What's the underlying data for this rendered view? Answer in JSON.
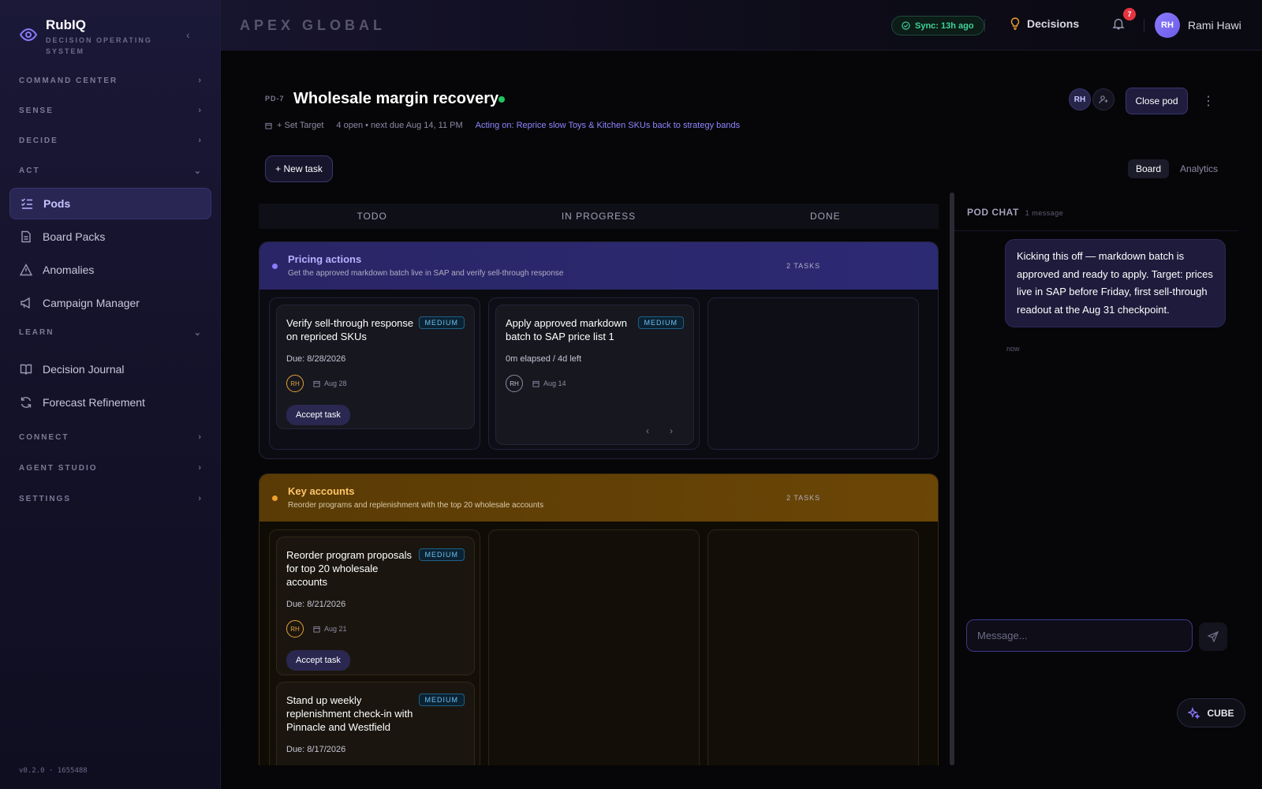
{
  "brand": {
    "name": "RubIQ",
    "tagline": "DECISION OPERATING SYSTEM"
  },
  "sidebar": {
    "sections": {
      "command_center": "COMMAND CENTER",
      "sense": "SENSE",
      "decide": "DECIDE",
      "act": "ACT",
      "learn": "LEARN",
      "connect": "CONNECT",
      "agent_studio": "AGENT STUDIO",
      "settings": "SETTINGS"
    },
    "act_items": [
      "Pods",
      "Board Packs",
      "Anomalies",
      "Campaign Manager"
    ],
    "learn_items": [
      "Decision Journal",
      "Forecast Refinement"
    ],
    "version": "v0.2.0 · 1655488"
  },
  "topbar": {
    "org": "APEX GLOBAL",
    "sync": "Sync: 13h ago",
    "decisions": "Decisions",
    "notifications": "7",
    "user_initials": "RH",
    "user_name": "Rami Hawi"
  },
  "pod": {
    "id": "PD-7",
    "title": "Wholesale margin recovery",
    "set_target": "+ Set Target",
    "open_summary": "4 open • next due Aug 14, 11 PM",
    "acting_on": "Acting on: Reprice slow Toys & Kitchen SKUs back to strategy bands",
    "member_initials": "RH",
    "close_label": "Close pod",
    "new_task": "+ New task",
    "views": [
      "Board",
      "Analytics"
    ]
  },
  "board": {
    "columns": [
      "TODO",
      "IN PROGRESS",
      "DONE"
    ],
    "groups": [
      {
        "name": "Pricing actions",
        "desc": "Get the approved markdown batch live in SAP and verify sell-through response",
        "count": "2 TASKS",
        "color": "#8b7bff",
        "cards": [
          {
            "title": "Verify sell-through response on repriced SKUs",
            "priority": "MEDIUM",
            "due": "Due: 8/28/2026",
            "assignee": "RH",
            "date": "Aug 28",
            "action": "Accept task"
          },
          {
            "title": "Apply approved markdown batch to SAP price list 1",
            "priority": "MEDIUM",
            "elapsed": "0m elapsed / 4d left",
            "assignee": "RH",
            "date": "Aug 14"
          }
        ]
      },
      {
        "name": "Key accounts",
        "desc": "Reorder programs and replenishment with the top 20 wholesale accounts",
        "count": "2 TASKS",
        "color": "#f0a030",
        "cards": [
          {
            "title": "Reorder program proposals for top 20 wholesale accounts",
            "priority": "MEDIUM",
            "due": "Due: 8/21/2026",
            "assignee": "RH",
            "date": "Aug 21",
            "action": "Accept task"
          },
          {
            "title": "Stand up weekly replenishment check-in with Pinnacle and Westfield",
            "priority": "MEDIUM",
            "due": "Due: 8/17/2026"
          }
        ]
      }
    ]
  },
  "chat": {
    "title": "POD CHAT",
    "count": "1 message",
    "message": "Kicking this off — markdown batch is approved and ready to apply. Target: prices live in SAP before Friday, first sell-through readout at the Aug 31 checkpoint.",
    "time": "now",
    "placeholder": "Message..."
  },
  "cube": "CUBE"
}
